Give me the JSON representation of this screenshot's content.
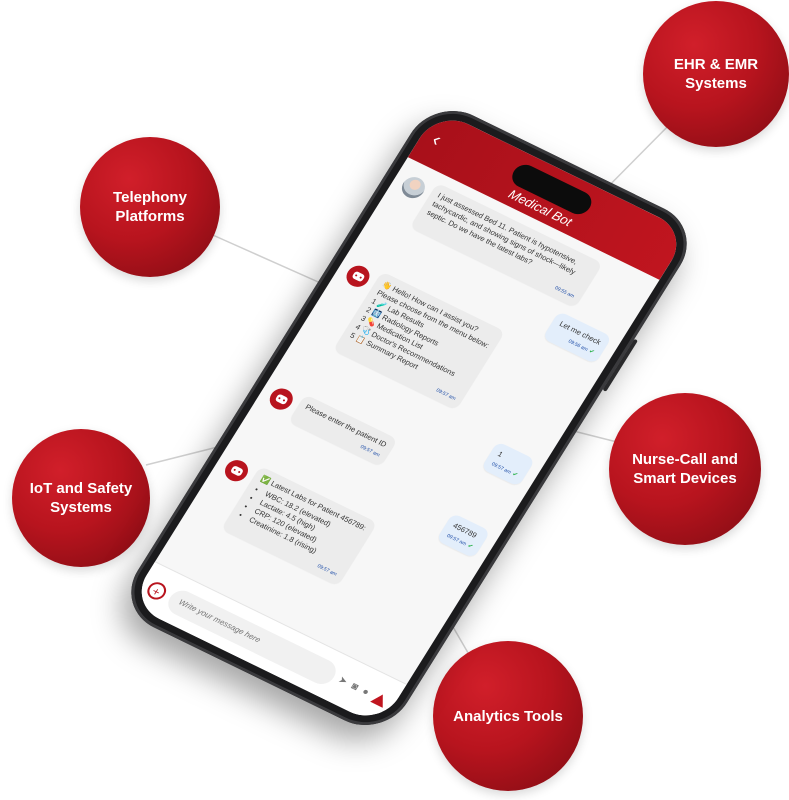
{
  "integrations": {
    "ehr": "EHR & EMR\nSystems",
    "telephony": "Telephony\nPlatforms",
    "nurse_call": "Nurse-Call and\nSmart Devices",
    "iot": "IoT and Safety\nSystems",
    "analytics": "Analytics Tools"
  },
  "app": {
    "back_icon": "chevron-left-icon",
    "title": "Medical Bot"
  },
  "messages": {
    "m1": {
      "text": "I just assessed Bed 11. Patient is hypotensive, tachycardic, and showing signs of shock—likely septic. Do we have the latest labs?",
      "time": "09:55 am"
    },
    "m2": {
      "text": "Let me check",
      "time": "09:56 am"
    },
    "m3": {
      "greeting": "👋 Hello! How can I assist you?",
      "prompt": "Please choose from the menu below:",
      "options": [
        "1 🧪 Lab Results",
        "2 🩻 Radiology Reports",
        "3 💊 Medication List",
        "4 🩺 Doctor's Recommendations",
        "5 📋 Summary Report"
      ],
      "time": "09:57 am"
    },
    "m4": {
      "text": "1",
      "time": "09:57 am"
    },
    "m5": {
      "text": "Please enter the patient ID",
      "time": "09:57 am"
    },
    "m6": {
      "text": "456789",
      "time": "09:57 am"
    },
    "m7": {
      "title": "✅ Latest Labs for Patient 456789:",
      "items": [
        "WBC: 18.2 (elevated)",
        "Lactate: 4.5 (high)",
        "CRP: 120 (elevated)",
        "Creatinine: 1.8 (rising)"
      ],
      "time": "09:57 am"
    }
  },
  "composer": {
    "placeholder": "Write your message here",
    "send_icon": "send-icon",
    "camera_icon": "camera-icon",
    "mic_icon": "mic-icon",
    "alert_icon": "alert-icon"
  },
  "colors": {
    "brand_red": "#b8141e",
    "bubble_bg": "#ececec",
    "my_bubble_bg": "#e3eefb"
  }
}
